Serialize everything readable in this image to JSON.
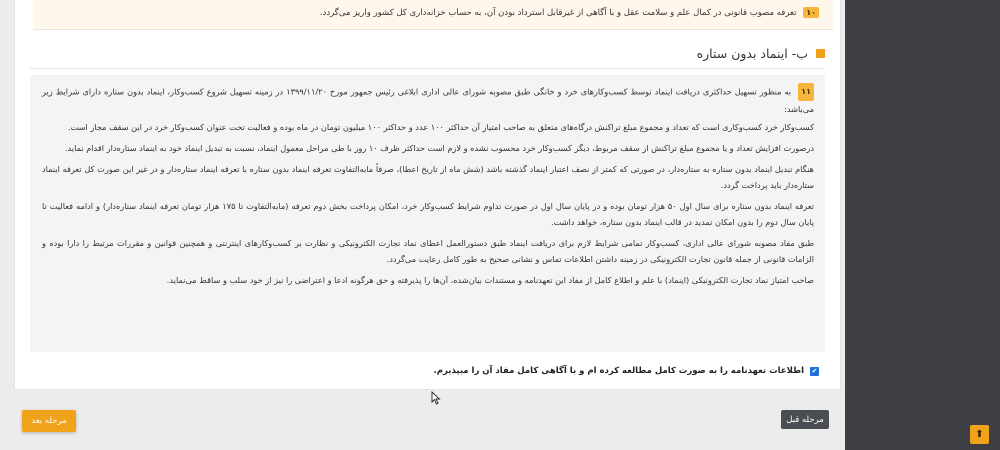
{
  "clause10": {
    "number": "۱۰",
    "text": "تعرفه مصوب قانونی در کمال علم و سلامت عقل و با آگاهی از غیرقابل استرداد بودن آن، به حساب خزانه‌داری کل کشور واریز می‌گردد."
  },
  "section": {
    "title": "ب- اینماد بدون ستاره"
  },
  "terms": {
    "number": "۱۱",
    "paragraphs": [
      "به منظور تسهیل حداکثری دریافت اینماد توسط کسب‌وکارهای خرد و خانگی طبق مصوبه شورای عالی اداری ابلاغی رئیس جمهور مورخ ۱۳۹۹/۱۱/۲۰ در زمینه تسهیل شروع کسب‌وکار، اینماد بدون ستاره دارای شرایط زیر می‌باشد:",
      "کسب‌وکار خرد کسب‌وکاری است که تعداد و مجموع مبلغ تراکنش درگاه‌های متعلق به صاحب امتیاز آن حداکثر ۱۰۰ عدد و حداکثر ۱۰۰ میلیون تومان در ماه بوده و فعالیت تحت عنوان کسب‌وکار خرد در این سقف مجاز است.",
      "درصورت افزایش تعداد و یا مجموع مبلغ تراکنش از سقف مربوط، دیگر کسب‌وکار خرد محسوب نشده و لازم است حداکثر ظرف ۱۰ روز با طی مراحل معمول اینماد، نسبت به تبدیل اینماد خود به اینماد ستاره‌دار اقدام نماید.",
      "هنگام تبدیل اینماد بدون ستاره به ستاره‌دار، در صورتی که کمتر از نصف اعتبار اینماد گذشته باشد (شش ماه از تاریخ اعطا)، صرفاً مابه‌التفاوت تعرفه اینماد بدون ستاره با تعرفه اینماد ستاره‌دار و در غیر این صورت کل تعرفه اینماد ستاره‌دار باید پرداخت گردد.",
      "تعرفه اینماد بدون ستاره برای سال اول ۵۰ هزار تومان بوده و در پایان سال اول در صورت تداوم شرایط کسب‌وکار خرد، امکان پرداخت بخش دوم تعرفه (مابه‌التفاوت تا ۱۷۵ هزار تومان تعرفه اینماد ستاره‌دار) و ادامه فعالیت تا پایان سال دوم را بدون امکان تمدید در قالب اینماد بدون ستاره، خواهد داشت.",
      "طبق مفاد مصوبه شورای عالی اداری، کسب‌وکار تمامی شرایط لازم برای دریافت اینماد طبق دستورالعمل اعطای نماد تجارت الکترونیکی و نظارت بر کسب‌وکارهای اینترنتی و همچنین قوانین و مقررات مرتبط را دارا بوده و الزامات قانونی از جمله قانون تجارت الکترونیکی در زمینه داشتن اطلاعات تماس و نشانی صحیح به طور کامل رعایت می‌گردد.",
      "صاحب امتیاز نماد تجارت الکترونیکی (اینماد) با علم و اطلاع کامل از مفاد این تعهدنامه و مستندات بیان‌شده، آن‌ها را پذیرفته و حق هرگونه ادعا و اعتراضی را نیز از خود سلب و ساقط می‌نماید."
    ]
  },
  "agreement": {
    "checked": true,
    "label": "اطلاعات تعهدنامه را به صورت کامل مطالعه کرده ام و با آگاهی کامل مفاد آن را میپذیرم."
  },
  "buttons": {
    "next_label": "مرحله بعد",
    "prev_label": "مرحله قبل",
    "scroll_top_symbol": "⬆"
  },
  "colors": {
    "accent": "#f0a21a",
    "dark_panel": "#3d3f44",
    "checkbox": "#1e6fd9"
  }
}
